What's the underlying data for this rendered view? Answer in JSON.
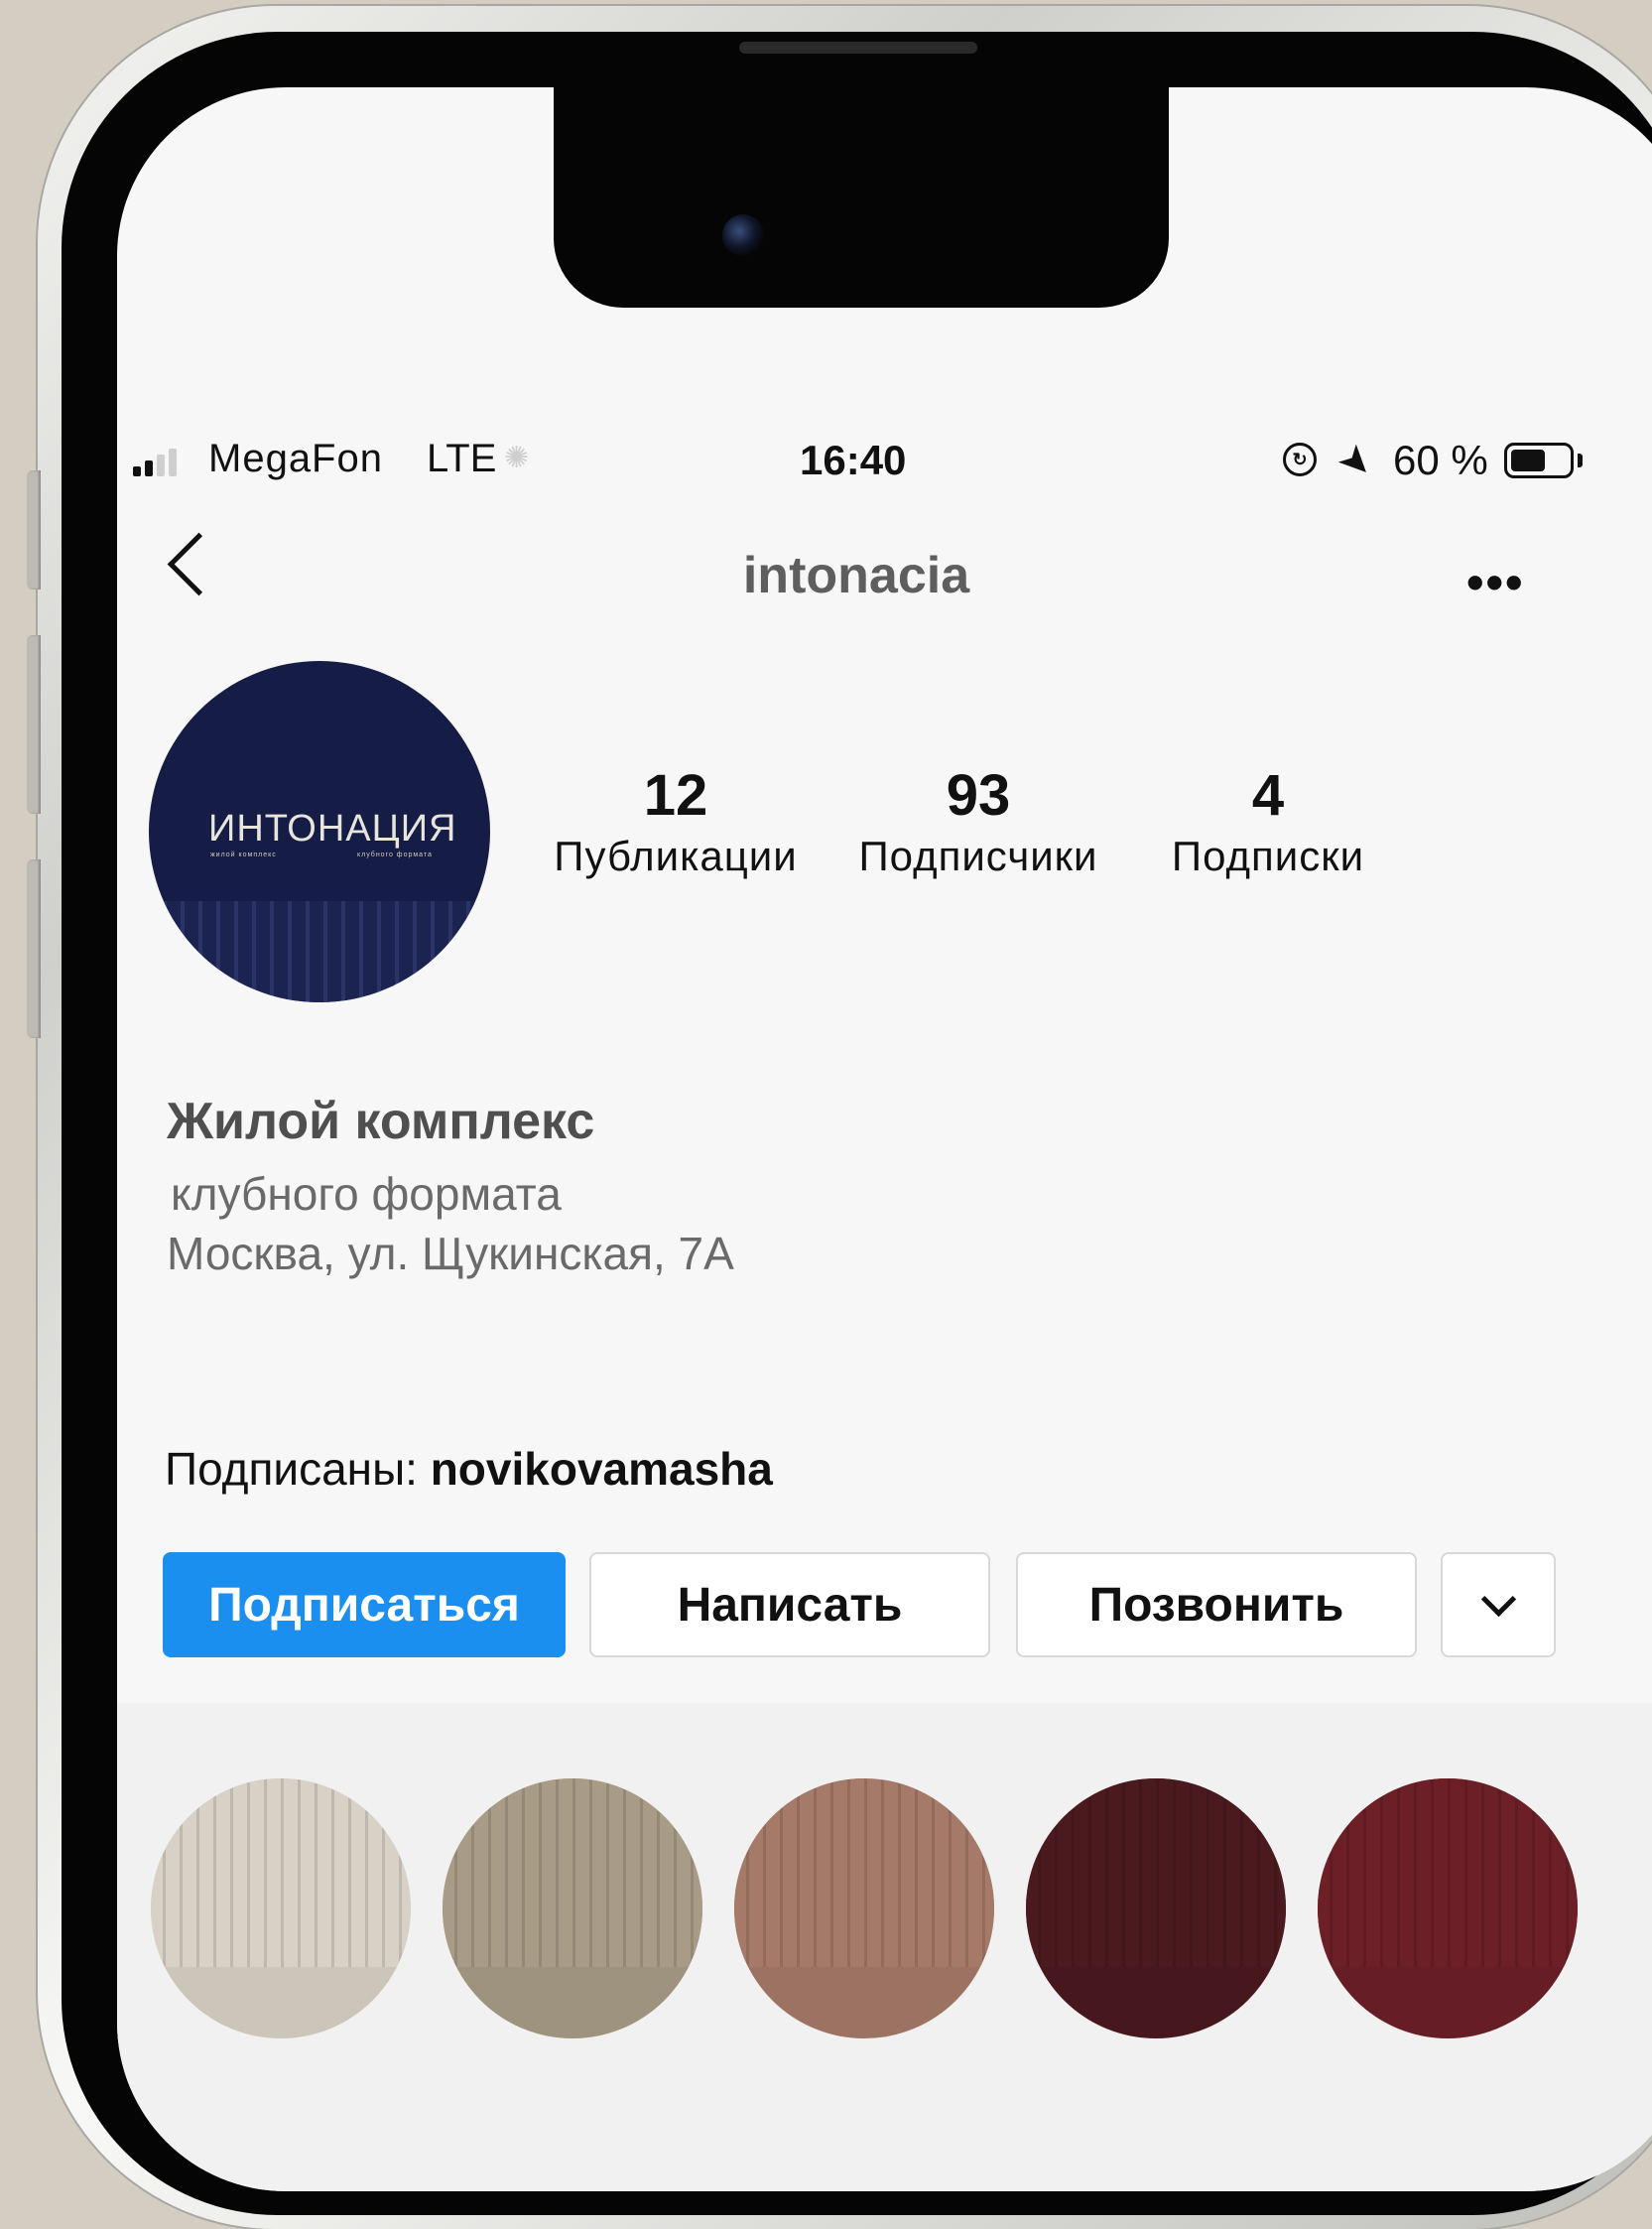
{
  "status_bar": {
    "carrier": "MegaFon",
    "network": "LTE",
    "time": "16:40",
    "battery_percent": "60 %",
    "battery_level": 0.6,
    "icons": [
      "signal-icon",
      "orientation-lock-icon",
      "location-icon",
      "battery-icon"
    ]
  },
  "nav": {
    "username": "intonacia",
    "back_icon": "chevron-left-icon",
    "more_icon": "more-horizontal-icon",
    "more_label": "•••"
  },
  "avatar": {
    "logo_text": "ИНТОНАЦИЯ",
    "sub_left": "жилой комплекс",
    "sub_right": "клубного формата",
    "color": "#151c45"
  },
  "stats": [
    {
      "value": "12",
      "label": "Публикации"
    },
    {
      "value": "93",
      "label": "Подписчики"
    },
    {
      "value": "4",
      "label": "Подписки"
    }
  ],
  "bio": {
    "name": "Жилой комплекс",
    "line1": "клубного формата",
    "line2": "Москва, ул. Щукинская, 7А"
  },
  "followed_by": {
    "prefix": "Подписаны: ",
    "user": "novikovamasha"
  },
  "buttons": {
    "follow": "Подписаться",
    "message": "Написать",
    "call": "Позвонить",
    "dropdown_icon": "chevron-down-icon"
  },
  "colors": {
    "accent": "#1a8ff0",
    "swatches": [
      "#d8d2c6",
      "#a89c86",
      "#a67a68",
      "#4a1a1f",
      "#6d1f27"
    ]
  }
}
